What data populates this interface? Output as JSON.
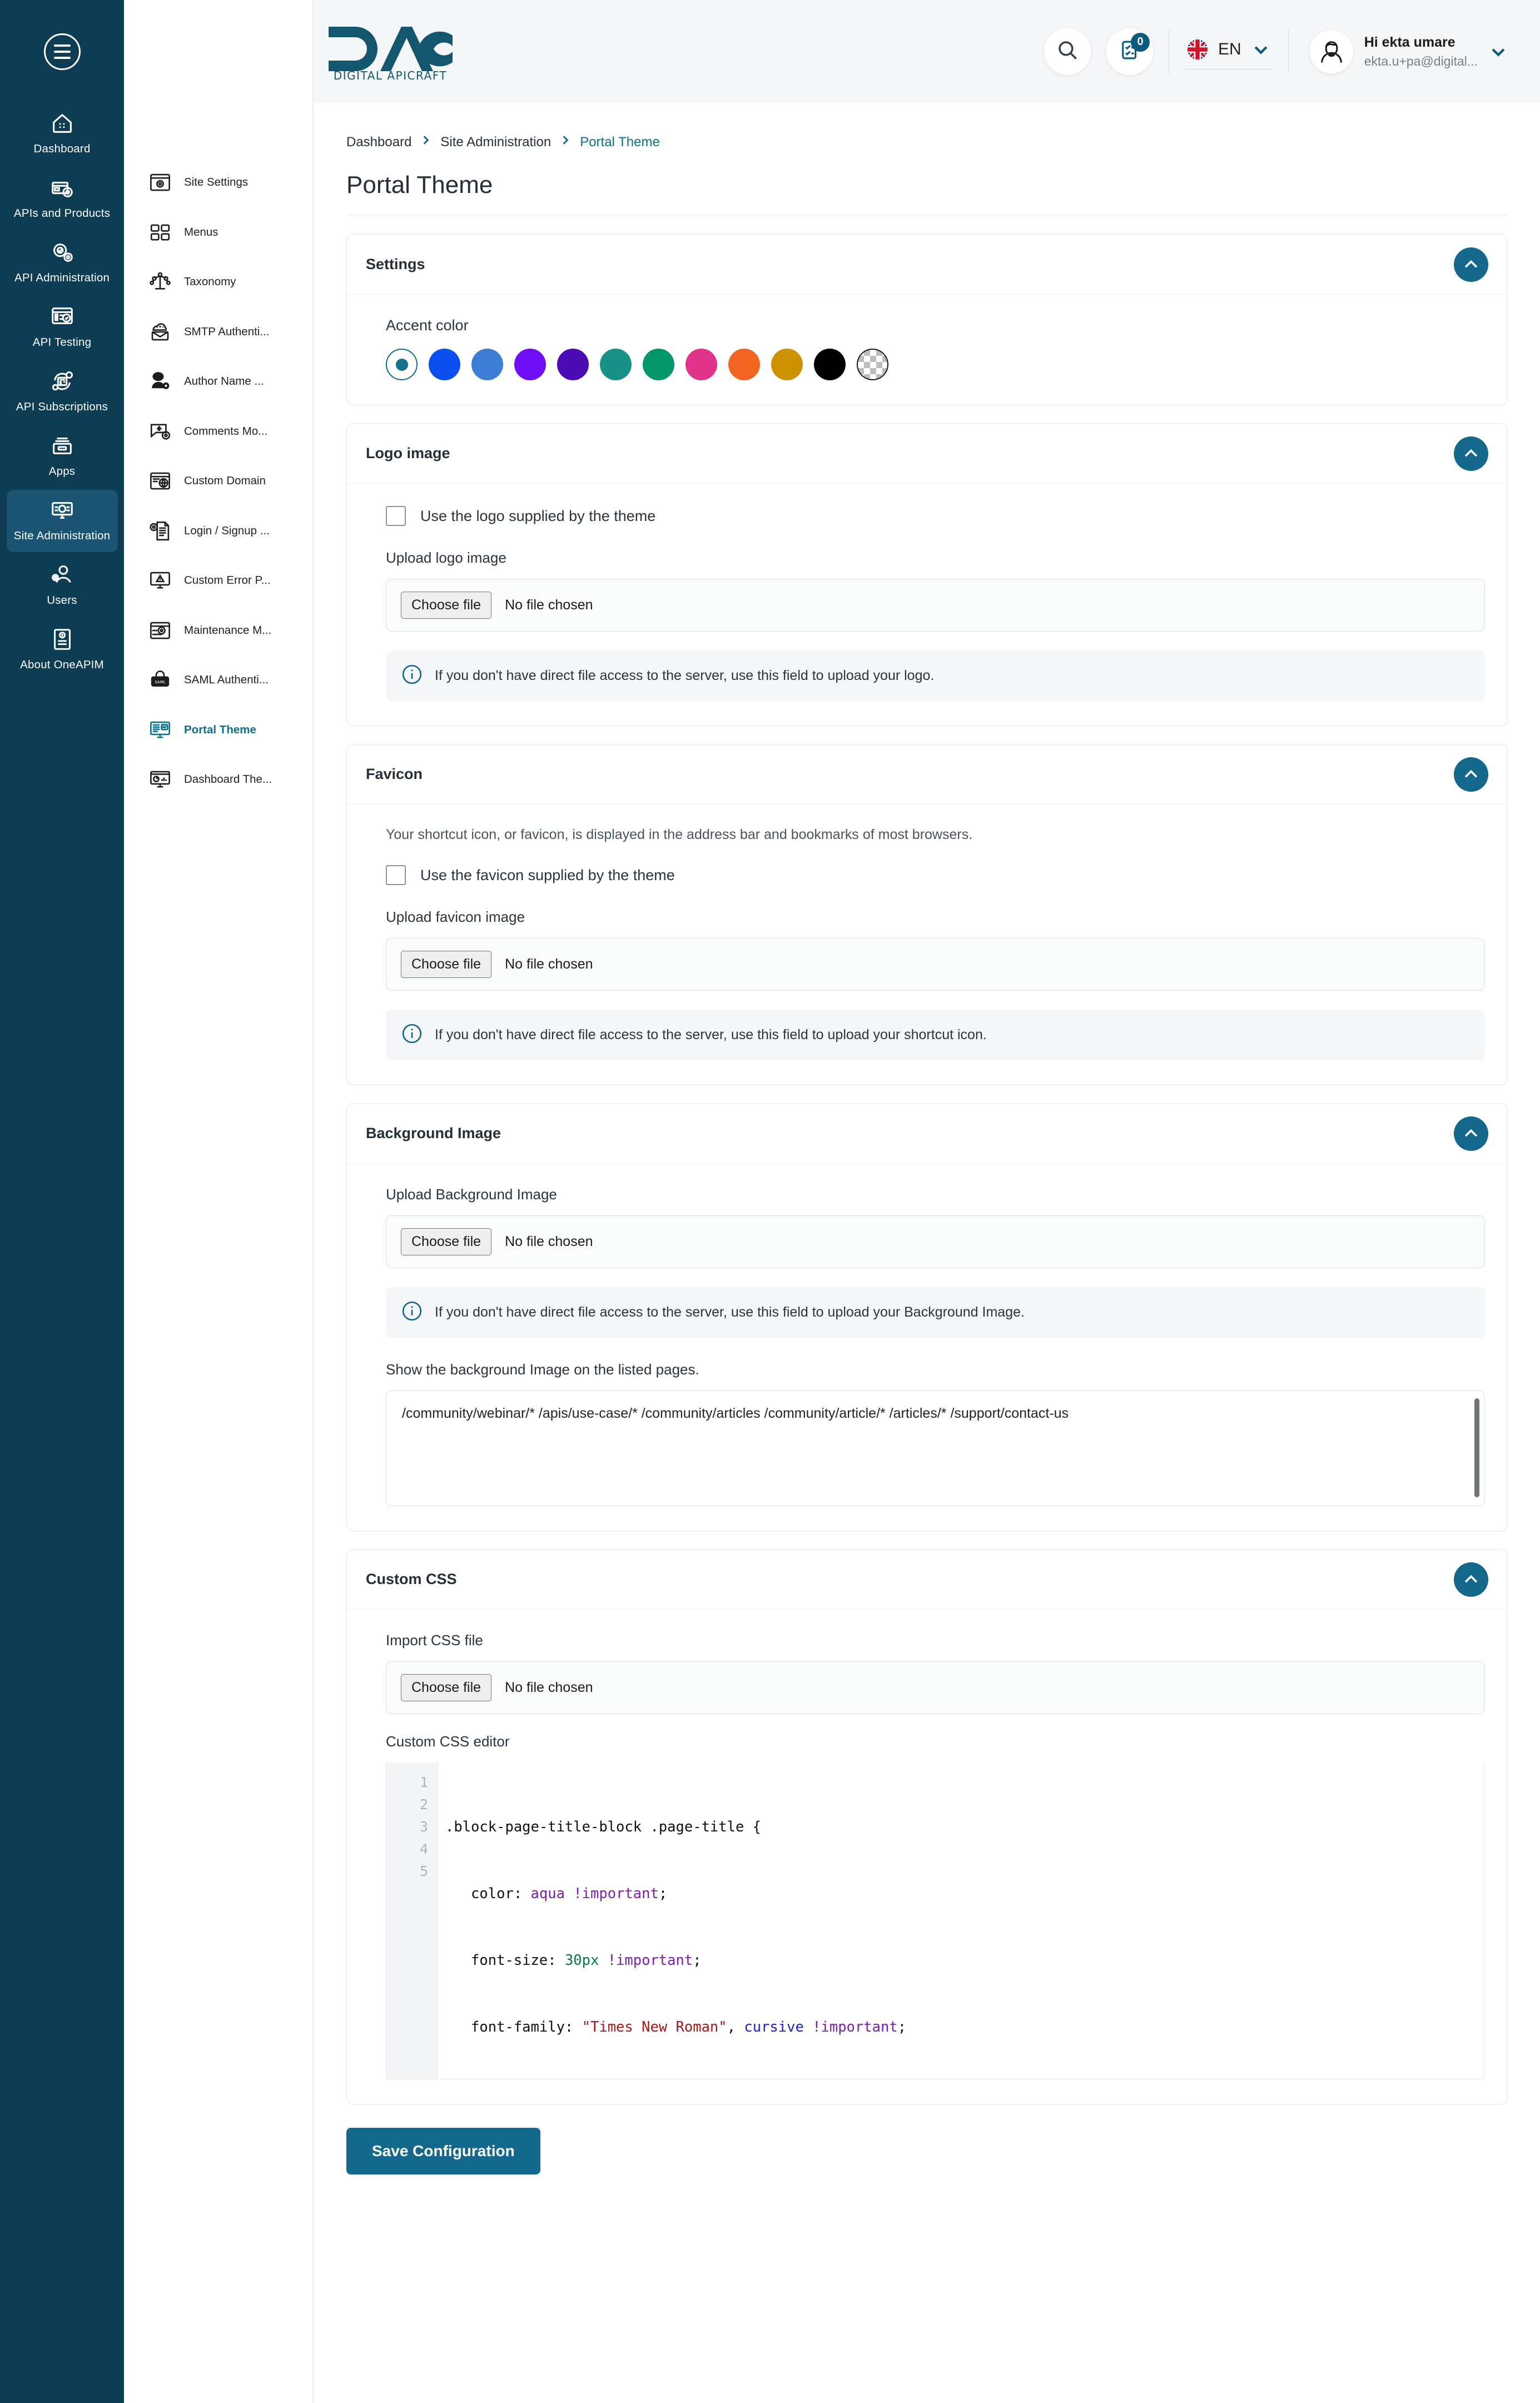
{
  "brand": {
    "name": "DAC",
    "tagline": "DIGITAL APICRAFT"
  },
  "header": {
    "search_icon": "search-icon",
    "tasks_icon": "tasks-clipboard-icon",
    "notification_count": "0",
    "language": {
      "code": "EN",
      "flag": "uk-flag-icon"
    },
    "user": {
      "greeting": "Hi ekta umare",
      "email": "ekta.u+pa@digital..."
    }
  },
  "rail": {
    "menu_icon": "hamburger-menu-icon",
    "items": [
      {
        "label": "Dashboard",
        "icon": "dashboard-home-icon",
        "active": false
      },
      {
        "label": "APIs and Products",
        "icon": "apis-products-box-icon",
        "active": false
      },
      {
        "label": "API Administration",
        "icon": "api-admin-gear-icon",
        "active": false
      },
      {
        "label": "API Testing",
        "icon": "api-testing-check-icon",
        "active": false
      },
      {
        "label": "API Subscriptions",
        "icon": "api-subscriptions-icon",
        "active": false
      },
      {
        "label": "Apps",
        "icon": "apps-tray-icon",
        "active": false
      },
      {
        "label": "Site Administration",
        "icon": "site-administration-monitor-icon",
        "active": true
      },
      {
        "label": "Users",
        "icon": "users-gear-icon",
        "active": false
      },
      {
        "label": "About OneAPIM",
        "icon": "about-document-icon",
        "active": false
      }
    ]
  },
  "subnav": {
    "items": [
      {
        "label": "Site Settings",
        "icon": "site-settings-window-gear-icon",
        "active": false
      },
      {
        "label": "Menus",
        "icon": "menus-grid-icon",
        "active": false
      },
      {
        "label": "Taxonomy",
        "icon": "taxonomy-tree-icon",
        "active": false
      },
      {
        "label": "SMTP Authenti...",
        "icon": "smtp-mail-cloud-icon",
        "active": false
      },
      {
        "label": "Author Name ...",
        "icon": "author-person-gear-icon",
        "active": false
      },
      {
        "label": "Comments Mo...",
        "icon": "comments-moderation-icon",
        "active": false
      },
      {
        "label": "Custom Domain",
        "icon": "custom-domain-globe-icon",
        "active": false
      },
      {
        "label": "Login / Signup ...",
        "icon": "login-signup-doc-gear-icon",
        "active": false
      },
      {
        "label": "Custom Error P...",
        "icon": "custom-error-page-icon",
        "active": false
      },
      {
        "label": "Maintenance M...",
        "icon": "maintenance-mode-icon",
        "active": false
      },
      {
        "label": "SAML Authenti...",
        "icon": "saml-authentication-icon",
        "active": false
      },
      {
        "label": "Portal Theme",
        "icon": "portal-theme-icon",
        "active": true
      },
      {
        "label": "Dashboard The...",
        "icon": "dashboard-theme-icon",
        "active": false
      }
    ]
  },
  "breadcrumb": {
    "items": [
      {
        "label": "Dashboard",
        "current": false
      },
      {
        "label": "Site Administration",
        "current": false
      },
      {
        "label": "Portal Theme",
        "current": true
      }
    ]
  },
  "page": {
    "title": "Portal Theme"
  },
  "panels": {
    "settings": {
      "title": "Settings",
      "accent_label": "Accent color",
      "accent_colors": [
        {
          "hex": "#15708f",
          "selected": true,
          "name": "teal-selected"
        },
        {
          "hex": "#0d4ef0",
          "selected": false,
          "name": "blue"
        },
        {
          "hex": "#3d7dd8",
          "selected": false,
          "name": "light-blue"
        },
        {
          "hex": "#6f0ef5",
          "selected": false,
          "name": "violet"
        },
        {
          "hex": "#4b0bb5",
          "selected": false,
          "name": "dark-purple"
        },
        {
          "hex": "#189287",
          "selected": false,
          "name": "teal-green"
        },
        {
          "hex": "#059669",
          "selected": false,
          "name": "green"
        },
        {
          "hex": "#e0338a",
          "selected": false,
          "name": "pink"
        },
        {
          "hex": "#f26522",
          "selected": false,
          "name": "orange"
        },
        {
          "hex": "#cc9100",
          "selected": false,
          "name": "gold"
        },
        {
          "hex": "#000000",
          "selected": false,
          "name": "black"
        },
        {
          "hex": "transparent",
          "selected": false,
          "name": "transparent-checker"
        }
      ]
    },
    "logo": {
      "title": "Logo image",
      "use_theme_label": "Use the logo supplied by the theme",
      "upload_label": "Upload logo image",
      "choose_file": "Choose file",
      "no_file": "No file chosen",
      "info": "If you don't have direct file access to the server, use this field to upload your logo."
    },
    "favicon": {
      "title": "Favicon",
      "description": "Your shortcut icon, or favicon, is displayed in the address bar and bookmarks of most browsers.",
      "use_theme_label": "Use the favicon supplied by the theme",
      "upload_label": "Upload favicon image",
      "choose_file": "Choose file",
      "no_file": "No file chosen",
      "info": "If you don't have direct file access to the server, use this field to upload your shortcut icon."
    },
    "background": {
      "title": "Background Image",
      "upload_label": "Upload Background Image",
      "choose_file": "Choose file",
      "no_file": "No file chosen",
      "info": "If you don't have direct file access to the server, use this field to upload your Background Image.",
      "pages_label": "Show the background Image on the listed pages.",
      "pages_value": "/community/webinar/*\n/apis/use-case/*\n/community/articles\n/community/article/*\n/articles/*\n/support/contact-us"
    },
    "custom_css": {
      "title": "Custom CSS",
      "import_label": "Import CSS file",
      "choose_file": "Choose file",
      "no_file": "No file chosen",
      "editor_label": "Custom CSS editor",
      "line_numbers": [
        "1",
        "2",
        "3",
        "4",
        "5"
      ],
      "code_lines": [
        ".block-page-title-block .page-title {",
        "   color: aqua !important;",
        "   font-size: 30px !important;",
        "   font-family: \"Times New Roman\", cursive !important;",
        "}"
      ]
    }
  },
  "actions": {
    "save_label": "Save Configuration"
  },
  "colors": {
    "accent": "#14688c",
    "rail_bg": "#0d3c53",
    "link": "#0b7089"
  }
}
